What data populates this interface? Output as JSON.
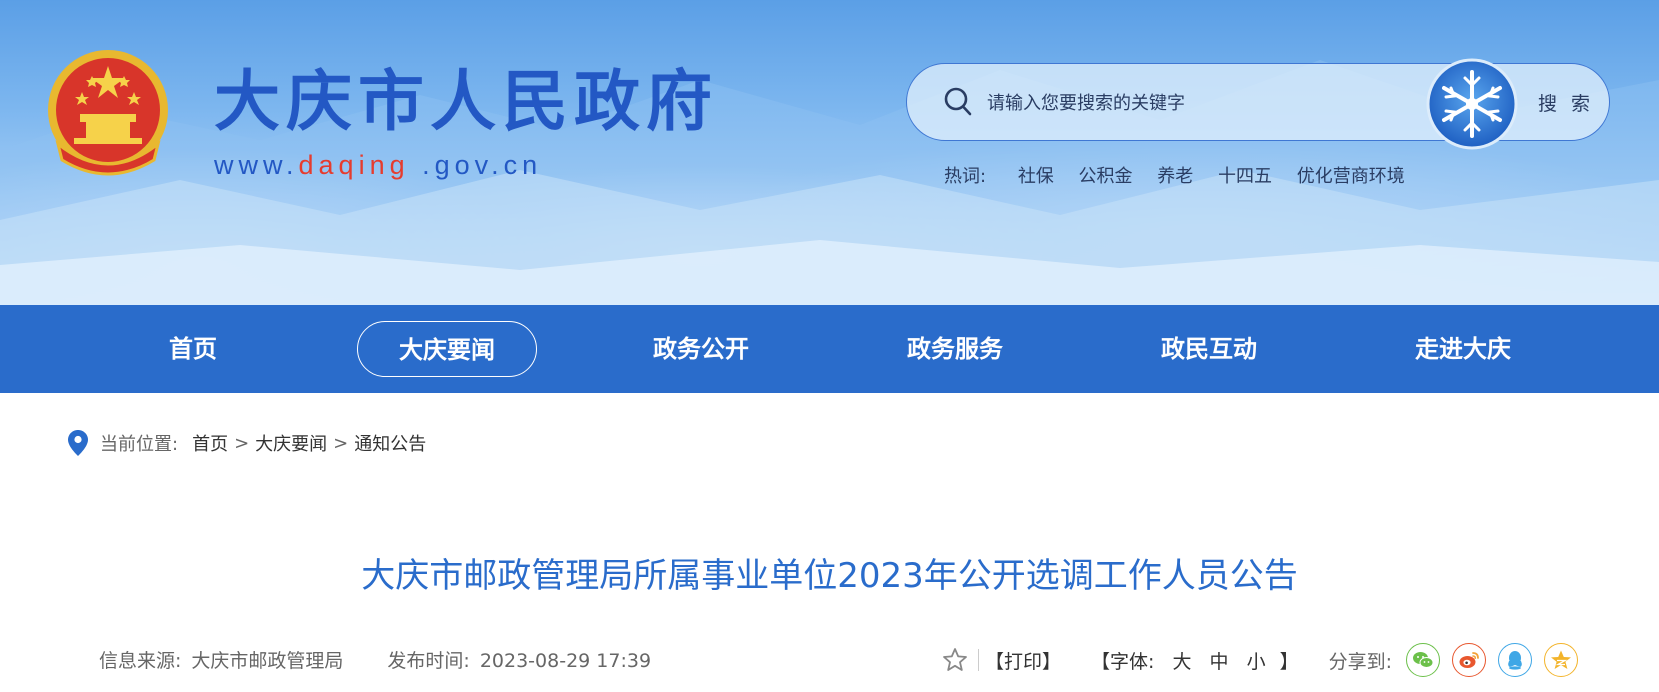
{
  "header": {
    "site_title": "大庆市人民政府",
    "url_prefix": "www.",
    "url_highlight": "daqing",
    "url_suffix": " .gov.cn",
    "search_placeholder": "请输入您要搜索的关键字",
    "search_button": "搜 索",
    "hot_label": "热词:",
    "hot_words": [
      "社保",
      "公积金",
      "养老",
      "十四五",
      "优化营商环境"
    ]
  },
  "nav": {
    "items": [
      "首页",
      "大庆要闻",
      "政务公开",
      "政务服务",
      "政民互动",
      "走进大庆"
    ],
    "active": "大庆要闻"
  },
  "breadcrumb": {
    "label": "当前位置:",
    "items": [
      "首页",
      "大庆要闻",
      "通知公告"
    ],
    "separator": ">"
  },
  "article": {
    "title": "大庆市邮政管理局所属事业单位2023年公开选调工作人员公告",
    "source_label": "信息来源:",
    "source": "大庆市邮政管理局",
    "time_label": "发布时间:",
    "time": "2023-08-29 17:39"
  },
  "tools": {
    "print": "【打印】",
    "font_open": "【字体:",
    "font_large": "大",
    "font_medium": "中",
    "font_small": "小",
    "font_close": "】",
    "share_label": "分享到:",
    "share_icons": [
      "wechat-icon",
      "weibo-icon",
      "qq-icon",
      "qzone-icon"
    ]
  },
  "colors": {
    "primary": "#2a6ccb",
    "title_blue": "#2358c4",
    "url_red": "#e63c2e",
    "wechat": "#6cc04a",
    "weibo": "#e8572e",
    "qq": "#3fa7e6",
    "qzone": "#f3b42b"
  }
}
